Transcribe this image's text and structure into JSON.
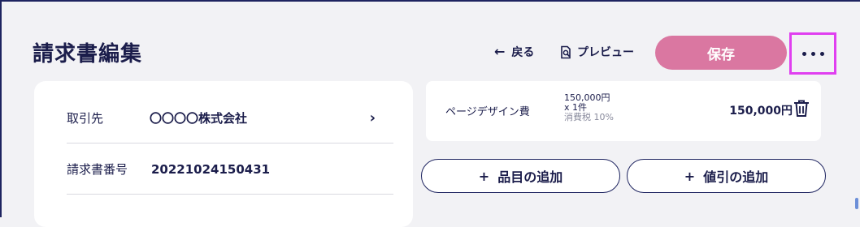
{
  "header": {
    "title": "請求書編集",
    "back_label": "戻る",
    "preview_label": "プレビュー",
    "save_label": "保存",
    "more_icon": "more-horizontal-icon"
  },
  "invoice": {
    "fields": [
      {
        "label": "取引先",
        "value": "〇〇〇〇株式会社"
      },
      {
        "label": "請求書番号",
        "value": "20221024150431"
      }
    ]
  },
  "line_item": {
    "name": "ページデザイン費",
    "unit_price": "150,000円",
    "quantity": "x 1件",
    "tax": "消費税 10%",
    "amount": "150,000円"
  },
  "actions": {
    "add_item_label": "品目の追加",
    "add_discount_label": "値引の追加"
  },
  "colors": {
    "primary_navy": "#1e2460",
    "save_pink": "#da77a1",
    "highlight_magenta": "#e03ff0",
    "background": "#f2f2f5"
  }
}
